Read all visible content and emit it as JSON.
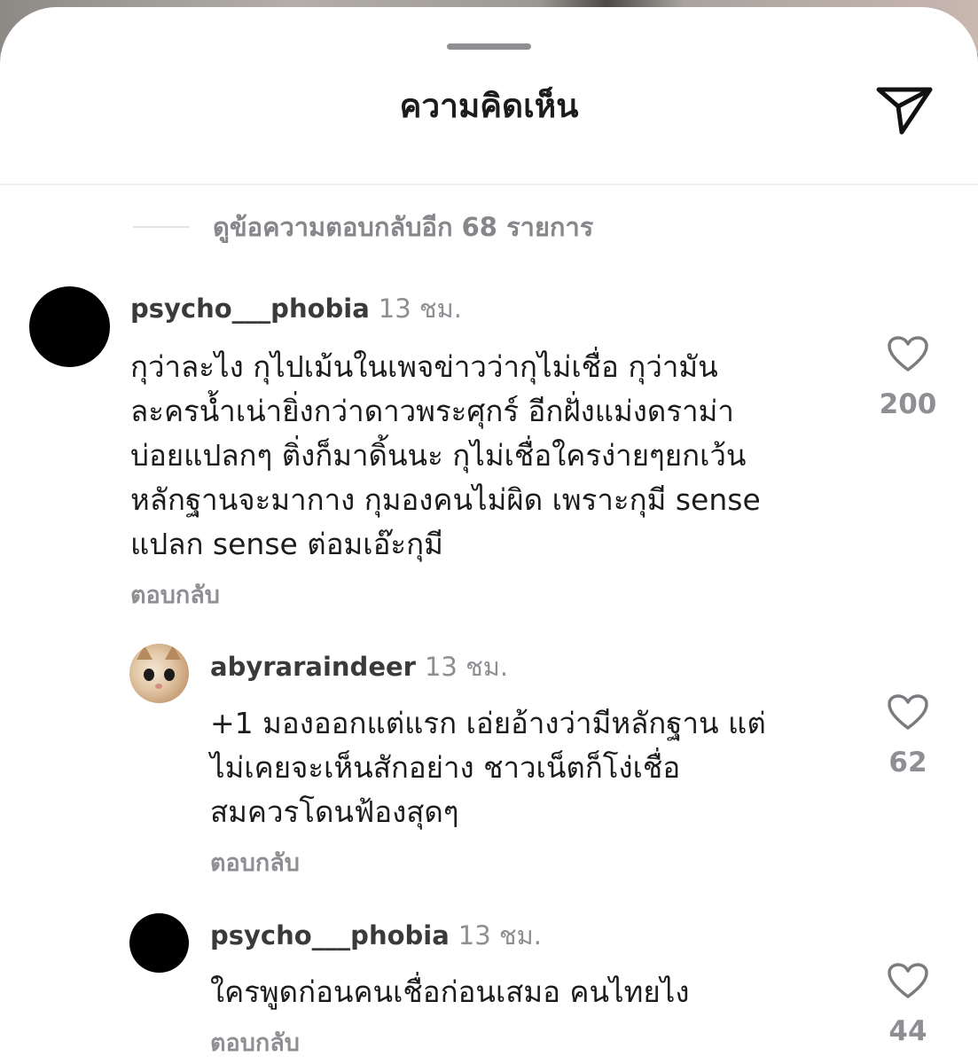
{
  "sheet": {
    "title": "ความคิดเห็น",
    "share_icon": "paper-plane-icon"
  },
  "view_more_replies": "ดูข้อความตอบกลับอีก 68 รายการ",
  "comments": [
    {
      "username": "psycho___phobia",
      "time": "13 ชม.",
      "lines": [
        "กุว่าละไง กุไปเม้นในเพจข่าวว่ากุไม่เชื่อ กุว่ามัน",
        "ละครน้ำเน่ายิ่งกว่าดาวพระศุกร์ อีกฝั่งแม่งดราม่า",
        "บ่อยแปลกๆ ติ่งก็มาดิ้นนะ กุไม่เชื่อใครง่ายๆยกเว้น",
        "หลักฐานจะมากาง กุมองคนไม่ผิด เพราะกุมี sense",
        "แปลก sense ต่อมเอ๊ะกุมี"
      ],
      "reply_label": "ตอบกลับ",
      "likes": "200"
    },
    {
      "username": "abyraraindeer",
      "time": "13 ชม.",
      "lines": [
        "+1 มองออกแต่แรก เอ่ยอ้างว่ามีหลักฐาน แต่",
        "ไม่เคยจะเห็นสักอย่าง ชาวเน็ตก็โง่เชื่อ",
        "สมควรโดนฟ้องสุดๆ"
      ],
      "reply_label": "ตอบกลับ",
      "likes": "62"
    },
    {
      "username": "psycho___phobia",
      "time": "13 ชม.",
      "lines": [
        "ใครพูดก่อนคนเชื่อก่อนเสมอ คนไทยไง"
      ],
      "reply_label": "ตอบกลับ",
      "likes": "44"
    }
  ],
  "colors": {
    "primary_text": "#1c1c1e",
    "secondary_text": "#8e8e93",
    "background": "#ffffff"
  }
}
